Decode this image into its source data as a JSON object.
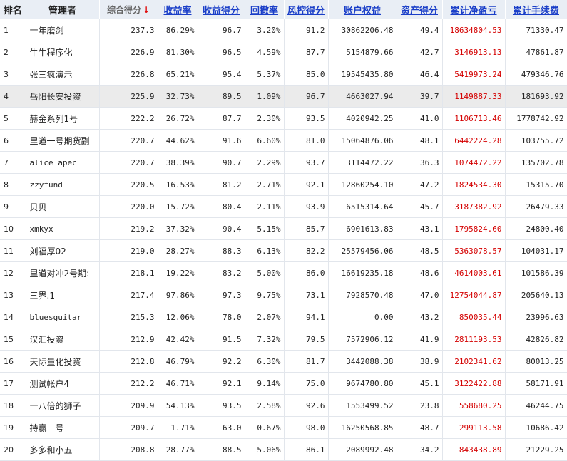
{
  "headers": {
    "rank": "排名",
    "manager": "管理者",
    "composite": "综合得分",
    "composite_arrow": "↓",
    "return_rate": "收益率",
    "return_score": "收益得分",
    "drawdown": "回撤率",
    "risk_score": "风控得分",
    "equity": "账户权益",
    "asset_score": "资产得分",
    "net_pnl": "累计净盈亏",
    "fees": "累计手续费"
  },
  "colors": {
    "header_bg": "#e9eef5",
    "link": "#1a3ec8",
    "pnl": "#d40000",
    "highlight_row": "#ebebeb",
    "sort_arrow": "#e01010"
  },
  "highlighted_rank": "4",
  "rows": [
    {
      "rank": "1",
      "manager": "十年磨剑",
      "composite": "237.3",
      "return_rate": "86.29%",
      "return_score": "96.7",
      "drawdown": "3.20%",
      "risk_score": "91.2",
      "equity": "30862206.48",
      "asset_score": "49.4",
      "net_pnl": "18634804.53",
      "fees": "71330.47"
    },
    {
      "rank": "2",
      "manager": "牛牛程序化",
      "composite": "226.9",
      "return_rate": "81.30%",
      "return_score": "96.5",
      "drawdown": "4.59%",
      "risk_score": "87.7",
      "equity": "5154879.66",
      "asset_score": "42.7",
      "net_pnl": "3146913.13",
      "fees": "47861.87"
    },
    {
      "rank": "3",
      "manager": "张三疯演示",
      "composite": "226.8",
      "return_rate": "65.21%",
      "return_score": "95.4",
      "drawdown": "5.37%",
      "risk_score": "85.0",
      "equity": "19545435.80",
      "asset_score": "46.4",
      "net_pnl": "5419973.24",
      "fees": "479346.76"
    },
    {
      "rank": "4",
      "manager": "岳阳长安投资",
      "composite": "225.9",
      "return_rate": "32.73%",
      "return_score": "89.5",
      "drawdown": "1.09%",
      "risk_score": "96.7",
      "equity": "4663027.94",
      "asset_score": "39.7",
      "net_pnl": "1149887.33",
      "fees": "181693.92"
    },
    {
      "rank": "5",
      "manager": "赫金系列1号",
      "composite": "222.2",
      "return_rate": "26.72%",
      "return_score": "87.7",
      "drawdown": "2.30%",
      "risk_score": "93.5",
      "equity": "4020942.25",
      "asset_score": "41.0",
      "net_pnl": "1106713.46",
      "fees": "1778742.92"
    },
    {
      "rank": "6",
      "manager": "里道一号期货副",
      "composite": "220.7",
      "return_rate": "44.62%",
      "return_score": "91.6",
      "drawdown": "6.60%",
      "risk_score": "81.0",
      "equity": "15064876.06",
      "asset_score": "48.1",
      "net_pnl": "6442224.28",
      "fees": "103755.72"
    },
    {
      "rank": "7",
      "manager": "alice_apec",
      "composite": "220.7",
      "return_rate": "38.39%",
      "return_score": "90.7",
      "drawdown": "2.29%",
      "risk_score": "93.7",
      "equity": "3114472.22",
      "asset_score": "36.3",
      "net_pnl": "1074472.22",
      "fees": "135702.78"
    },
    {
      "rank": "8",
      "manager": "zzyfund",
      "composite": "220.5",
      "return_rate": "16.53%",
      "return_score": "81.2",
      "drawdown": "2.71%",
      "risk_score": "92.1",
      "equity": "12860254.10",
      "asset_score": "47.2",
      "net_pnl": "1824534.30",
      "fees": "15315.70"
    },
    {
      "rank": "9",
      "manager": "贝贝",
      "composite": "220.0",
      "return_rate": "15.72%",
      "return_score": "80.4",
      "drawdown": "2.11%",
      "risk_score": "93.9",
      "equity": "6515314.64",
      "asset_score": "45.7",
      "net_pnl": "3187382.92",
      "fees": "26479.33"
    },
    {
      "rank": "10",
      "manager": "xmkyx",
      "composite": "219.2",
      "return_rate": "37.32%",
      "return_score": "90.4",
      "drawdown": "5.15%",
      "risk_score": "85.7",
      "equity": "6901613.83",
      "asset_score": "43.1",
      "net_pnl": "1795824.60",
      "fees": "24800.40"
    },
    {
      "rank": "11",
      "manager": "刘福厚02",
      "composite": "219.0",
      "return_rate": "28.27%",
      "return_score": "88.3",
      "drawdown": "6.13%",
      "risk_score": "82.2",
      "equity": "25579456.06",
      "asset_score": "48.5",
      "net_pnl": "5363078.57",
      "fees": "104031.17"
    },
    {
      "rank": "12",
      "manager": "里道对冲2号期:",
      "composite": "218.1",
      "return_rate": "19.22%",
      "return_score": "83.2",
      "drawdown": "5.00%",
      "risk_score": "86.0",
      "equity": "16619235.18",
      "asset_score": "48.6",
      "net_pnl": "4614003.61",
      "fees": "101586.39"
    },
    {
      "rank": "13",
      "manager": "三界.1",
      "composite": "217.4",
      "return_rate": "97.86%",
      "return_score": "97.3",
      "drawdown": "9.75%",
      "risk_score": "73.1",
      "equity": "7928570.48",
      "asset_score": "47.0",
      "net_pnl": "12754044.87",
      "fees": "205640.13"
    },
    {
      "rank": "14",
      "manager": "bluesguitar",
      "composite": "215.3",
      "return_rate": "12.06%",
      "return_score": "78.0",
      "drawdown": "2.07%",
      "risk_score": "94.1",
      "equity": "0.00",
      "asset_score": "43.2",
      "net_pnl": "850035.44",
      "fees": "23996.63"
    },
    {
      "rank": "15",
      "manager": "汉汇投资",
      "composite": "212.9",
      "return_rate": "42.42%",
      "return_score": "91.5",
      "drawdown": "7.32%",
      "risk_score": "79.5",
      "equity": "7572906.12",
      "asset_score": "41.9",
      "net_pnl": "2811193.53",
      "fees": "42826.82"
    },
    {
      "rank": "16",
      "manager": "天际量化投资",
      "composite": "212.8",
      "return_rate": "46.79%",
      "return_score": "92.2",
      "drawdown": "6.30%",
      "risk_score": "81.7",
      "equity": "3442088.38",
      "asset_score": "38.9",
      "net_pnl": "2102341.62",
      "fees": "80013.25"
    },
    {
      "rank": "17",
      "manager": "测试帐户4",
      "composite": "212.2",
      "return_rate": "46.71%",
      "return_score": "92.1",
      "drawdown": "9.14%",
      "risk_score": "75.0",
      "equity": "9674780.80",
      "asset_score": "45.1",
      "net_pnl": "3122422.88",
      "fees": "58171.91"
    },
    {
      "rank": "18",
      "manager": "十八倍的狮子",
      "composite": "209.9",
      "return_rate": "54.13%",
      "return_score": "93.5",
      "drawdown": "2.58%",
      "risk_score": "92.6",
      "equity": "1553499.52",
      "asset_score": "23.8",
      "net_pnl": "558680.25",
      "fees": "46244.75"
    },
    {
      "rank": "19",
      "manager": "持赢一号",
      "composite": "209.7",
      "return_rate": "1.71%",
      "return_score": "63.0",
      "drawdown": "0.67%",
      "risk_score": "98.0",
      "equity": "16250568.85",
      "asset_score": "48.7",
      "net_pnl": "299113.58",
      "fees": "10686.42"
    },
    {
      "rank": "20",
      "manager": "多多和小五",
      "composite": "208.8",
      "return_rate": "28.77%",
      "return_score": "88.5",
      "drawdown": "5.06%",
      "risk_score": "86.1",
      "equity": "2089992.48",
      "asset_score": "34.2",
      "net_pnl": "843438.89",
      "fees": "21229.25"
    }
  ]
}
